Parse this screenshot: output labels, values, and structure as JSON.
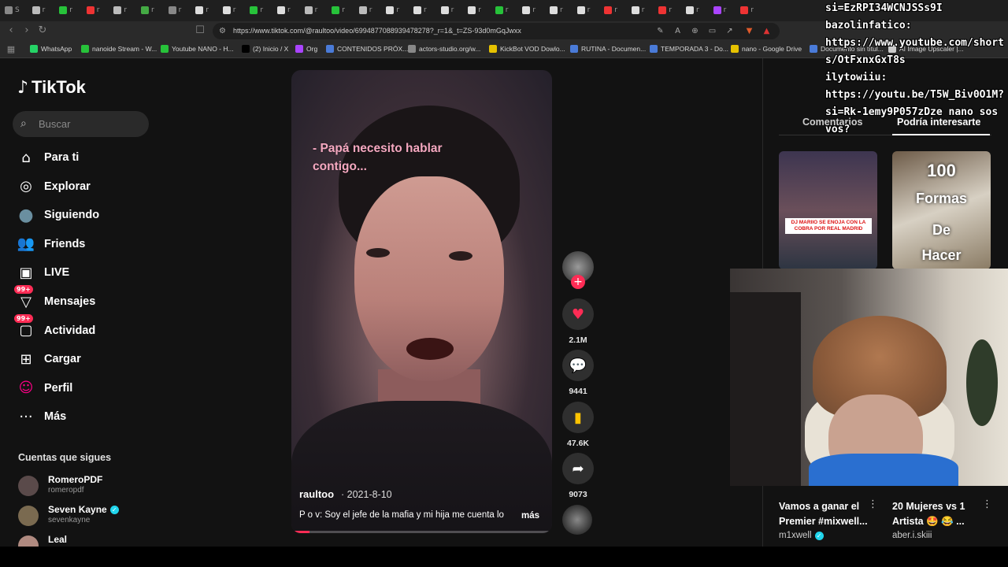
{
  "browser": {
    "tabs": [
      "S",
      "r",
      "r",
      "r",
      "r",
      "r",
      "r",
      "r",
      "r",
      "r",
      "r",
      "r",
      "r",
      "r",
      "r",
      "r",
      "r",
      "r",
      "r",
      "r",
      "r",
      "r",
      "r",
      "r",
      "r",
      "r",
      "r",
      "r"
    ],
    "url": "https://www.tiktok.com/@raultoo/video/6994877088939478278?_r=1&_t=ZS-93d0mGqJwxx",
    "bookmarks": [
      "WhatsApp",
      "nanoide Stream - W...",
      "Youtube NANO - H...",
      "(2) Inicio / X",
      "Org",
      "CONTENIDOS PRÓX...",
      "actors-studio.org/w...",
      "KickBot VOD Dowlo...",
      "RUTINA - Documen...",
      "TEMPORADA 3 - Do...",
      "nano - Google Drive",
      "Documento sin títul...",
      "AI Image Upscaler |..."
    ]
  },
  "tiktok": {
    "logo": "TikTok",
    "search_placeholder": "Buscar",
    "nav": [
      {
        "label": "Para ti",
        "icon": "home-icon"
      },
      {
        "label": "Explorar",
        "icon": "compass-icon"
      },
      {
        "label": "Siguiendo",
        "icon": "following-avatar-icon"
      },
      {
        "label": "Friends",
        "icon": "friends-icon"
      },
      {
        "label": "LIVE",
        "icon": "live-icon"
      },
      {
        "label": "Mensajes",
        "icon": "messages-icon",
        "badge": "99+"
      },
      {
        "label": "Actividad",
        "icon": "activity-icon",
        "badge": "99+"
      },
      {
        "label": "Cargar",
        "icon": "upload-icon"
      },
      {
        "label": "Perfil",
        "icon": "profile-avatar-icon"
      },
      {
        "label": "Más",
        "icon": "more-icon"
      }
    ],
    "following_title": "Cuentas que sigues",
    "following": [
      {
        "name": "RomeroPDF",
        "handle": "romeropdf",
        "verified": false
      },
      {
        "name": "Seven Kayne",
        "handle": "sevenkayne",
        "verified": true
      },
      {
        "name": "Leal",
        "handle": "",
        "verified": false
      }
    ]
  },
  "video": {
    "caption": "- Papá necesito hablar contigo...",
    "username": "raultoo",
    "date": "· 2021-8-10",
    "description": "P o v: Soy el jefe de la mafia y mi hija me cuenta lo",
    "more": "más",
    "progress": 0.07,
    "actions": {
      "likes": "2.1M",
      "comments": "9441",
      "saves": "47.6K",
      "shares": "9073"
    },
    "colors": {
      "like": "#fe2c55",
      "save": "#ffc300",
      "caption": "#f5a8c0"
    }
  },
  "right_panel": {
    "tabs": [
      "Comentarios",
      "Podría interesarte"
    ],
    "active_tab": "Podría interesarte",
    "cards": [
      {
        "thumb_text": "DJ MARIIO SE ENOJA CON LA COBRA POR REAL MADRID",
        "title": "Vamos a ganar el Premier #mixwell...",
        "user": "m1xwell",
        "verified": true
      },
      {
        "thumb_text": [
          "100",
          "Formas",
          "De",
          "Hacer"
        ],
        "title": "20 Mujeres vs 1 Artista 🤩 😂 ...",
        "user": "aber.i.skiii",
        "verified": false
      }
    ]
  },
  "chat": [
    {
      "user": "",
      "text": "si=EzRPI34WCNJSSs9I"
    },
    {
      "user": "bazolinfatico:",
      "text": "https://www.youtube.com/shorts/OtFxnxGxT8s"
    },
    {
      "user": "ilytowiiu:",
      "text": "https://youtu.be/T5W_Biv0O1M?si=Rk-1emy9P057zDze nano sos vos?"
    }
  ]
}
